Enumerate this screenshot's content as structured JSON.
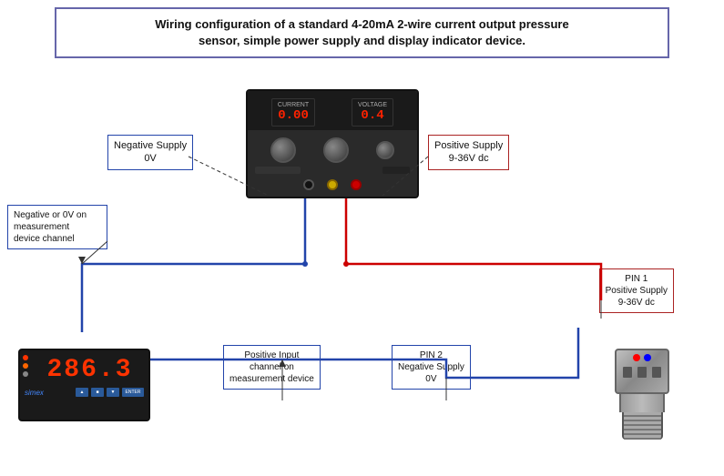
{
  "title": {
    "line1": "Wiring configuration of a standard 4-20mA 2-wire current output pressure",
    "line2": "sensor, simple power supply and display indicator device."
  },
  "labels": {
    "negative_supply_ps": "Negative Supply\n0V",
    "positive_supply_ps": "Positive Supply\n9-36V dc",
    "negative_meas": "Negative or 0V on\nmeasurement\ndevice channel",
    "positive_input": "Positive Input\nchannel on\nmeasurement device",
    "pin1": "PIN 1\nPositive Supply\n9-36V dc",
    "pin2": "PIN 2\nNegative Supply\n0V"
  },
  "meas_device": {
    "display": "286.3",
    "brand": "simex",
    "btn1": "▲",
    "btn2": "■",
    "btn3": "▼",
    "btn4": "ENTER"
  },
  "power_supply": {
    "current_label": "CURRENT",
    "voltage_label": "VOLTAGE",
    "current_value": "0.00",
    "voltage_value": "0.4"
  }
}
